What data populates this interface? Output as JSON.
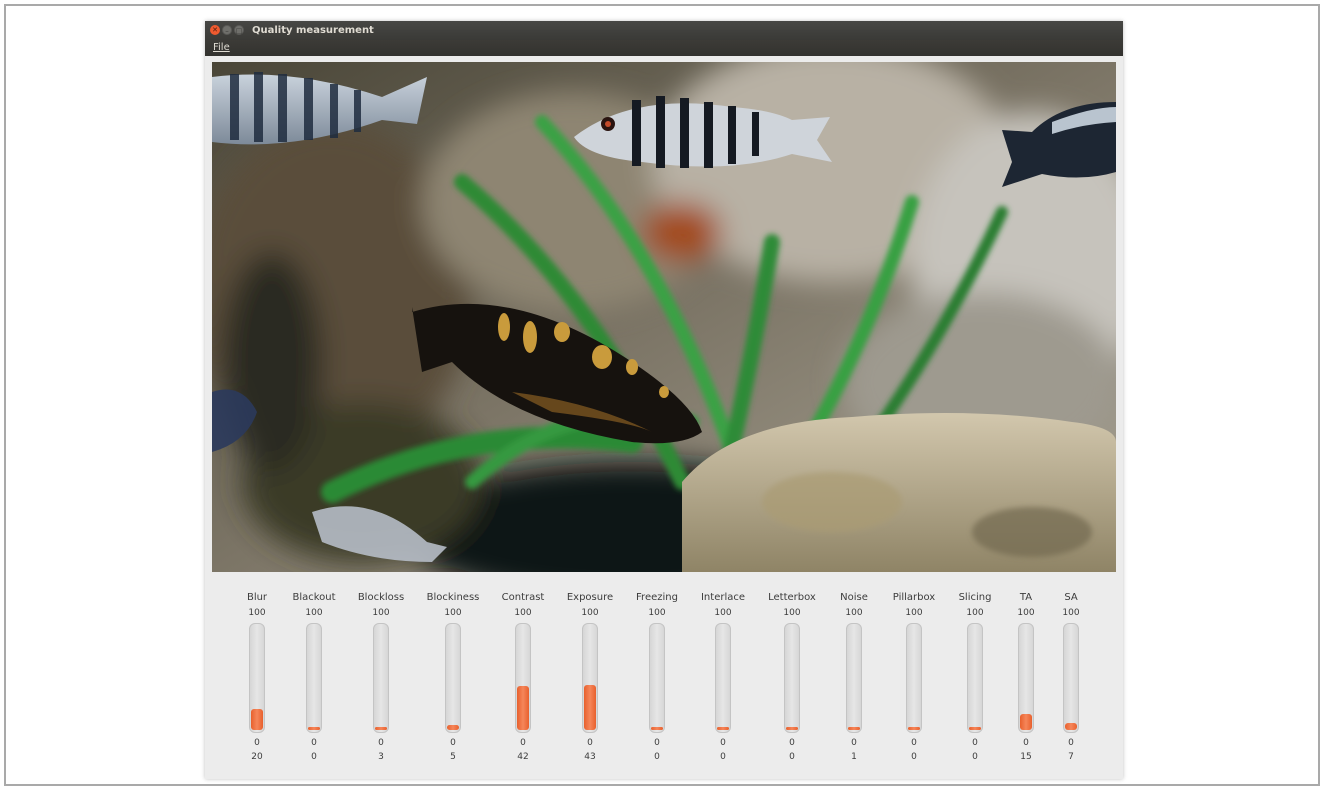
{
  "window": {
    "title": "Quality measurement"
  },
  "menu": {
    "file": "File"
  },
  "meters": [
    {
      "label": "Blur",
      "max": "100",
      "min": "0",
      "value": "20",
      "level": 0.2
    },
    {
      "label": "Blackout",
      "max": "100",
      "min": "0",
      "value": "0",
      "level": 0
    },
    {
      "label": "Blockloss",
      "max": "100",
      "min": "0",
      "value": "3",
      "level": 0.03
    },
    {
      "label": "Blockiness",
      "max": "100",
      "min": "0",
      "value": "5",
      "level": 0.05
    },
    {
      "label": "Contrast",
      "max": "100",
      "min": "0",
      "value": "42",
      "level": 0.42
    },
    {
      "label": "Exposure",
      "max": "100",
      "min": "0",
      "value": "43",
      "level": 0.43
    },
    {
      "label": "Freezing",
      "max": "100",
      "min": "0",
      "value": "0",
      "level": 0
    },
    {
      "label": "Interlace",
      "max": "100",
      "min": "0",
      "value": "0",
      "level": 0
    },
    {
      "label": "Letterbox",
      "max": "100",
      "min": "0",
      "value": "0",
      "level": 0
    },
    {
      "label": "Noise",
      "max": "100",
      "min": "0",
      "value": "1",
      "level": 0.01
    },
    {
      "label": "Pillarbox",
      "max": "100",
      "min": "0",
      "value": "0",
      "level": 0
    },
    {
      "label": "Slicing",
      "max": "100",
      "min": "0",
      "value": "0",
      "level": 0
    },
    {
      "label": "TA",
      "max": "100",
      "min": "0",
      "value": "15",
      "level": 0.15
    },
    {
      "label": "SA",
      "max": "100",
      "min": "0",
      "value": "7",
      "level": 0.07
    }
  ]
}
